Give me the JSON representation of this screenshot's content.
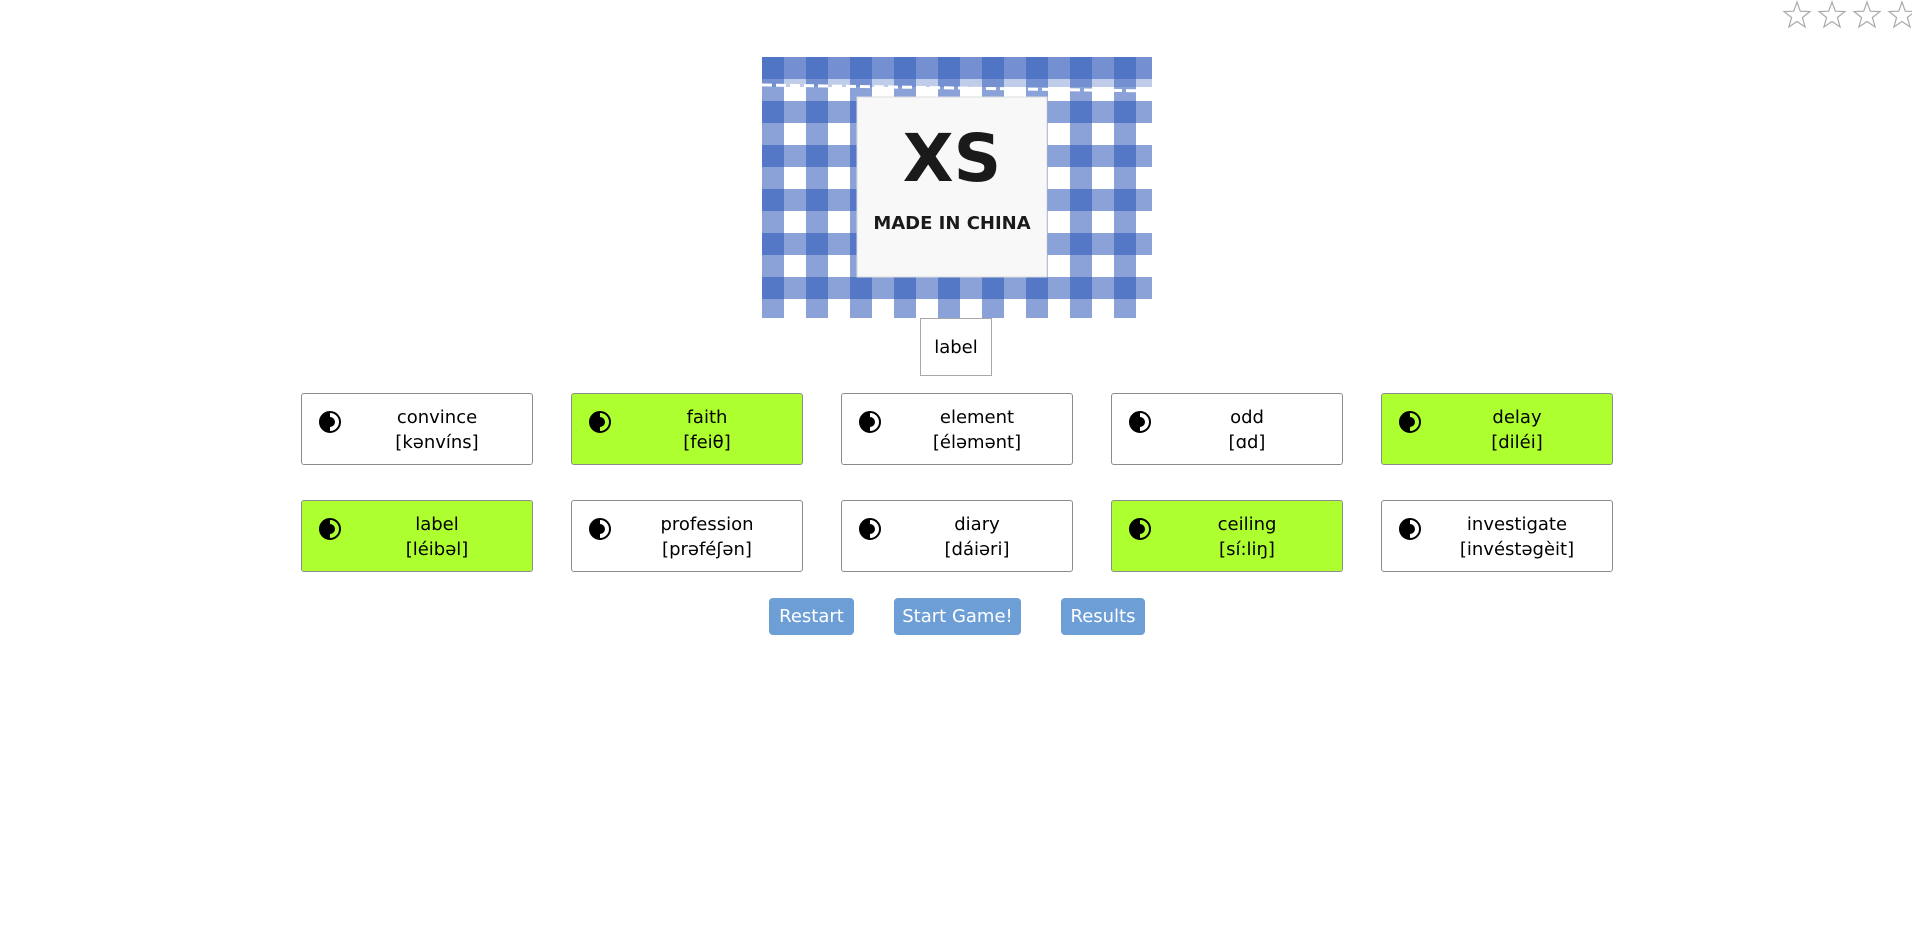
{
  "rating": {
    "stars": [
      "star-empty-icon",
      "star-empty-icon",
      "star-empty-icon",
      "star-empty-icon"
    ]
  },
  "picture": {
    "tag_size_text": "XS",
    "tag_origin_text": "MADE IN CHINA"
  },
  "target_word": "label",
  "cards": [
    {
      "word": "convince",
      "phonetic": "[kənvíns]",
      "matched": false
    },
    {
      "word": "faith",
      "phonetic": "[feiθ]",
      "matched": true
    },
    {
      "word": "element",
      "phonetic": "[éləmənt]",
      "matched": false
    },
    {
      "word": "odd",
      "phonetic": "[ɑd]",
      "matched": false
    },
    {
      "word": "delay",
      "phonetic": "[diléi]",
      "matched": true
    },
    {
      "word": "label",
      "phonetic": "[léibəl]",
      "matched": true
    },
    {
      "word": "profession",
      "phonetic": "[prəféʃən]",
      "matched": false
    },
    {
      "word": "diary",
      "phonetic": "[dáiəri]",
      "matched": false
    },
    {
      "word": "ceiling",
      "phonetic": "[sí:liŋ]",
      "matched": true
    },
    {
      "word": "investigate",
      "phonetic": "[invéstəgèit]",
      "matched": false
    }
  ],
  "buttons": {
    "restart": "Restart",
    "start_game": "Start Game!",
    "results": "Results"
  },
  "colors": {
    "matched_card": "#adff2f",
    "button": "#6d9fd6",
    "tag_check_blue": "#2a55b8"
  },
  "icons": {
    "card_speaker": "speaker-icon"
  }
}
